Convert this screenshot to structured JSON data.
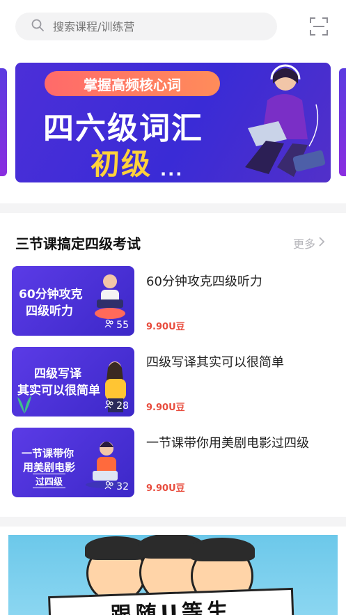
{
  "search": {
    "placeholder": "搜索课程/训练营"
  },
  "banner": {
    "pill_text": "掌握高频核心词",
    "title": "四六级词汇",
    "level": "初级",
    "dots": "..."
  },
  "section": {
    "title": "三节课搞定四级考试",
    "more_label": "更多"
  },
  "courses": [
    {
      "thumb_line1": "60分钟攻克",
      "thumb_line2": "四级听力",
      "count": "55",
      "name": "60分钟攻克四级听力",
      "price": "9.90U豆"
    },
    {
      "thumb_line1": "四级写译",
      "thumb_line2": "其实可以很简单",
      "count": "28",
      "name": "四级写译其实可以很简单",
      "price": "9.90U豆"
    },
    {
      "thumb_line1": "一节课带你",
      "thumb_line2": "用美剧电影",
      "thumb_line3": "过四级",
      "count": "32",
      "name": "一节课带你用美剧电影过四级",
      "price": "9.90U豆"
    }
  ],
  "bottom_banner": {
    "sign_text": "跟随U等生"
  },
  "icons": {
    "search": "search-icon",
    "scan": "scan-icon",
    "more": "chevron-right-icon",
    "students": "user-group-icon"
  },
  "colors": {
    "price": "#e84c3d",
    "accent_purple": "#4c2fd8",
    "yellow": "#ffd23b"
  }
}
